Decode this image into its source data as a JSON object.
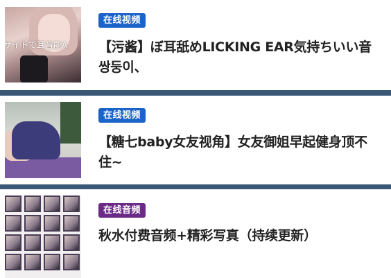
{
  "items": [
    {
      "badge": "在线视频",
      "badge_color": "#1b63c9",
      "title": "【污酱】ぼ耳舐めLICKING EAR気持ちいい音 쌍둥이、",
      "thumbnail_overlay_text": "サイトで耳音能A"
    },
    {
      "badge": "在线视频",
      "badge_color": "#1b63c9",
      "title": "【糖七baby女友视角】女友御姐早起健身顶不住~",
      "thumbnail_overlay_text": ""
    },
    {
      "badge": "在线音频",
      "badge_color": "#6a2a86",
      "title": "秋水付费音频+精彩写真（持续更新）",
      "thumbnail_overlay_text": ""
    }
  ],
  "colors": {
    "divider": "#3a5876",
    "title_text": "#222222"
  }
}
